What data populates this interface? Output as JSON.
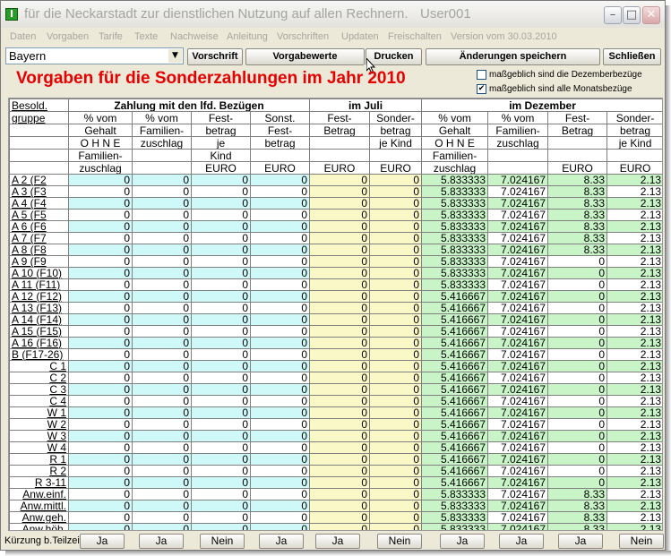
{
  "window": {
    "title": "für die Neckarstadt zur dienstlichen Nutzung auf allen Rechnern.",
    "user": "User001",
    "minimize_glyph": "–",
    "maximize_glyph": "□",
    "close_glyph": "✕"
  },
  "menu": [
    "Daten",
    "Vorgaben",
    "Tarife",
    "Texte",
    "Nachweise",
    "Anleitung",
    "Vorschriften",
    "Updaten",
    "Freischalten",
    "Version vom 30.03.2010"
  ],
  "toolbar": {
    "state_value": "Bayern",
    "vorschrift": "Vorschrift",
    "vorgabewerte": "Vorgabewerte",
    "drucken": "Drucken",
    "aenderungen": "Änderungen speichern",
    "schliessen": "Schließen"
  },
  "heading": "Vorgaben für die Sonderzahlungen im Jahr 2010",
  "options": [
    {
      "label": "maßgeblich sind die Dezemberbezüge",
      "checked": false
    },
    {
      "label": "maßgeblich sind alle Monatsbezüge",
      "checked": true
    }
  ],
  "table": {
    "group_headers": {
      "besold": [
        "Besold.",
        "gruppe"
      ],
      "lfd": "Zahlung mit den lfd. Bezügen",
      "juli": "im Juli",
      "dez": "im Dezember"
    },
    "col_headers": [
      [
        "% vom",
        "Gehalt",
        "O H N E",
        "Familien-",
        "zuschlag"
      ],
      [
        "% vom",
        "Familien-",
        "zuschlag",
        "",
        ""
      ],
      [
        "Fest-",
        "betrag",
        "je",
        "Kind",
        "EURO"
      ],
      [
        "Sonst.",
        "Fest-",
        "betrag",
        "",
        "EURO"
      ],
      [
        "Fest-",
        "Betrag",
        "",
        "",
        "EURO"
      ],
      [
        "Sonder-",
        "betrag",
        "je Kind",
        "",
        "EURO"
      ],
      [
        "% vom",
        "Gehalt",
        "O H N E",
        "Familien-",
        "zuschlag"
      ],
      [
        "% vom",
        "Familien-",
        "zuschlag",
        "",
        ""
      ],
      [
        "Fest-",
        "Betrag",
        "",
        "",
        "EURO"
      ],
      [
        "Sonder-",
        "betrag",
        "je Kind",
        "",
        "EURO"
      ]
    ],
    "rows": [
      {
        "g": "A 2  (F2",
        "v": [
          "0",
          "0",
          "0",
          "0",
          "0",
          "0",
          "5.833333",
          "7.024167",
          "8.33",
          "2.13"
        ]
      },
      {
        "g": "A 3  (F3",
        "v": [
          "0",
          "0",
          "0",
          "0",
          "0",
          "0",
          "5.833333",
          "7.024167",
          "8.33",
          "2.13"
        ]
      },
      {
        "g": "A 4  (F4",
        "v": [
          "0",
          "0",
          "0",
          "0",
          "0",
          "0",
          "5.833333",
          "7.024167",
          "8.33",
          "2.13"
        ]
      },
      {
        "g": "A 5  (F5",
        "v": [
          "0",
          "0",
          "0",
          "0",
          "0",
          "0",
          "5.833333",
          "7.024167",
          "8.33",
          "2.13"
        ]
      },
      {
        "g": "A 6  (F6",
        "v": [
          "0",
          "0",
          "0",
          "0",
          "0",
          "0",
          "5.833333",
          "7.024167",
          "8.33",
          "2.13"
        ]
      },
      {
        "g": "A 7  (F7",
        "v": [
          "0",
          "0",
          "0",
          "0",
          "0",
          "0",
          "5.833333",
          "7.024167",
          "8.33",
          "2.13"
        ]
      },
      {
        "g": "A 8  (F8",
        "v": [
          "0",
          "0",
          "0",
          "0",
          "0",
          "0",
          "5.833333",
          "7.024167",
          "8.33",
          "2.13"
        ]
      },
      {
        "g": "A 9  (F9",
        "v": [
          "0",
          "0",
          "0",
          "0",
          "0",
          "0",
          "5.833333",
          "7.024167",
          "0",
          "2.13"
        ]
      },
      {
        "g": "A 10 (F10)",
        "v": [
          "0",
          "0",
          "0",
          "0",
          "0",
          "0",
          "5.833333",
          "7.024167",
          "0",
          "2.13"
        ]
      },
      {
        "g": "A 11 (F11)",
        "v": [
          "0",
          "0",
          "0",
          "0",
          "0",
          "0",
          "5.833333",
          "7.024167",
          "0",
          "2.13"
        ]
      },
      {
        "g": "A 12 (F12)",
        "v": [
          "0",
          "0",
          "0",
          "0",
          "0",
          "0",
          "5.416667",
          "7.024167",
          "0",
          "2.13"
        ]
      },
      {
        "g": "A 13 (F13)",
        "v": [
          "0",
          "0",
          "0",
          "0",
          "0",
          "0",
          "5.416667",
          "7.024167",
          "0",
          "2.13"
        ]
      },
      {
        "g": "A 14 (F14)",
        "v": [
          "0",
          "0",
          "0",
          "0",
          "0",
          "0",
          "5.416667",
          "7.024167",
          "0",
          "2.13"
        ]
      },
      {
        "g": "A 15 (F15)",
        "v": [
          "0",
          "0",
          "0",
          "0",
          "0",
          "0",
          "5.416667",
          "7.024167",
          "0",
          "2.13"
        ]
      },
      {
        "g": "A 16 (F16)",
        "v": [
          "0",
          "0",
          "0",
          "0",
          "0",
          "0",
          "5.416667",
          "7.024167",
          "0",
          "2.13"
        ]
      },
      {
        "g": "B (F17-26)",
        "v": [
          "0",
          "0",
          "0",
          "0",
          "0",
          "0",
          "5.416667",
          "7.024167",
          "0",
          "2.13"
        ]
      },
      {
        "g": "C 1",
        "v": [
          "0",
          "0",
          "0",
          "0",
          "0",
          "0",
          "5.416667",
          "7.024167",
          "0",
          "2.13"
        ]
      },
      {
        "g": "C 2",
        "v": [
          "0",
          "0",
          "0",
          "0",
          "0",
          "0",
          "5.416667",
          "7.024167",
          "0",
          "2.13"
        ]
      },
      {
        "g": "C 3",
        "v": [
          "0",
          "0",
          "0",
          "0",
          "0",
          "0",
          "5.416667",
          "7.024167",
          "0",
          "2.13"
        ]
      },
      {
        "g": "C 4",
        "v": [
          "0",
          "0",
          "0",
          "0",
          "0",
          "0",
          "5.416667",
          "7.024167",
          "0",
          "2.13"
        ]
      },
      {
        "g": "W 1",
        "v": [
          "0",
          "0",
          "0",
          "0",
          "0",
          "0",
          "5.416667",
          "7.024167",
          "0",
          "2.13"
        ]
      },
      {
        "g": "W 2",
        "v": [
          "0",
          "0",
          "0",
          "0",
          "0",
          "0",
          "5.416667",
          "7.024167",
          "0",
          "2.13"
        ]
      },
      {
        "g": "W 3",
        "v": [
          "0",
          "0",
          "0",
          "0",
          "0",
          "0",
          "5.416667",
          "7.024167",
          "0",
          "2.13"
        ]
      },
      {
        "g": "W 4",
        "v": [
          "0",
          "0",
          "0",
          "0",
          "0",
          "0",
          "5.416667",
          "7.024167",
          "0",
          "2.13"
        ]
      },
      {
        "g": "R 1",
        "v": [
          "0",
          "0",
          "0",
          "0",
          "0",
          "0",
          "5.416667",
          "7.024167",
          "0",
          "2.13"
        ]
      },
      {
        "g": "R 2",
        "v": [
          "0",
          "0",
          "0",
          "0",
          "0",
          "0",
          "5.416667",
          "7.024167",
          "0",
          "2.13"
        ]
      },
      {
        "g": "R 3-11",
        "v": [
          "0",
          "0",
          "0",
          "0",
          "0",
          "0",
          "5.416667",
          "7.024167",
          "0",
          "2.13"
        ]
      },
      {
        "g": "Anw.einf.",
        "v": [
          "0",
          "0",
          "0",
          "0",
          "0",
          "0",
          "5.833333",
          "7.024167",
          "8.33",
          "2.13"
        ]
      },
      {
        "g": "Anw.mittl.",
        "v": [
          "0",
          "0",
          "0",
          "0",
          "0",
          "0",
          "5.833333",
          "7.024167",
          "8.33",
          "2.13"
        ]
      },
      {
        "g": "Anw.geh.",
        "v": [
          "0",
          "0",
          "0",
          "0",
          "0",
          "0",
          "5.833333",
          "7.024167",
          "8.33",
          "2.13"
        ]
      },
      {
        "g": "Anw.höh.",
        "v": [
          "0",
          "0",
          "0",
          "0",
          "0",
          "0",
          "5.833333",
          "7.024167",
          "8.33",
          "2.13"
        ]
      }
    ]
  },
  "footer": {
    "label": "Kürzung b.Teilzeit",
    "buttons": [
      "Ja",
      "Ja",
      "Nein",
      "Ja",
      "Ja",
      "Nein",
      "Ja",
      "Ja",
      "Ja",
      "Nein"
    ]
  },
  "colors": {
    "heading": "#e80000",
    "cyan": "#cff8f8",
    "yellow": "#fbf8c8",
    "green": "#c8f4c8"
  }
}
